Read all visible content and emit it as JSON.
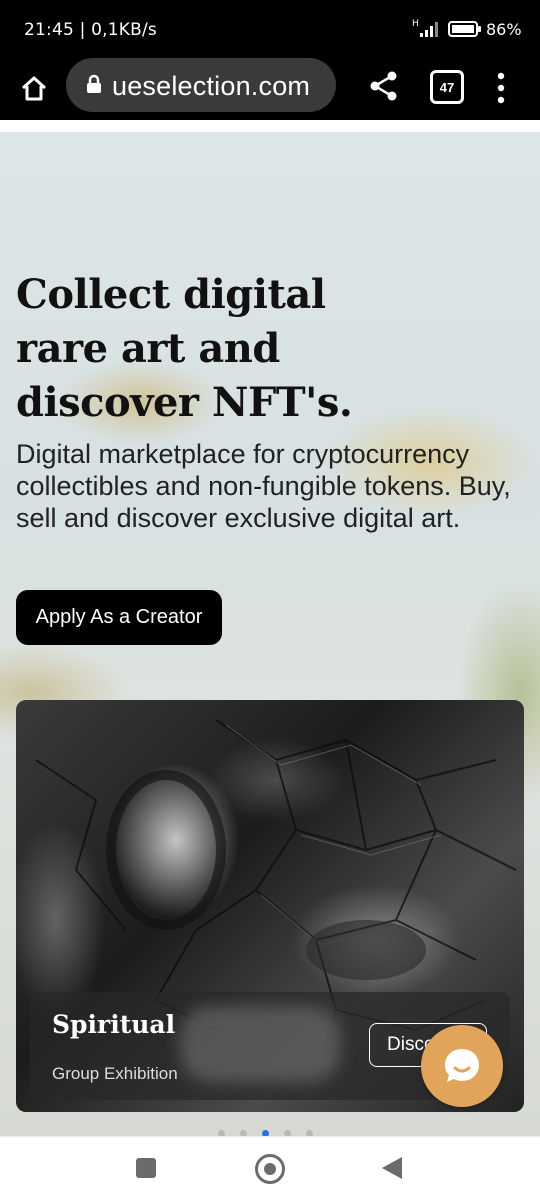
{
  "status_bar": {
    "time": "21:45 | 0,1KB/s",
    "network": "H",
    "battery": "86%"
  },
  "browser": {
    "url": "ueselection.com",
    "tab_count": "47",
    "icons": [
      "home-icon",
      "lock-icon",
      "share-icon",
      "tabs-icon",
      "more-vert-icon"
    ]
  },
  "hero": {
    "title": "Collect digital rare art and discover NFT's.",
    "subtitle": "Digital marketplace for cryptocurrency collectibles and non-fungible tokens. Buy, sell and discover exclusive digital art.",
    "cta_label": "Apply As a Creator"
  },
  "featured": {
    "title": "Spiritual",
    "subtitle": "Group Exhibition",
    "button_label": "Discover"
  },
  "carousel": {
    "slide_count": 5,
    "active_index": 2
  },
  "colors": {
    "chat_button": "#e2a45a",
    "cta_background": "#000000",
    "page_background": "#dfe6e6"
  },
  "nav_icons": [
    "recents-icon",
    "home-circle-icon",
    "back-icon"
  ]
}
